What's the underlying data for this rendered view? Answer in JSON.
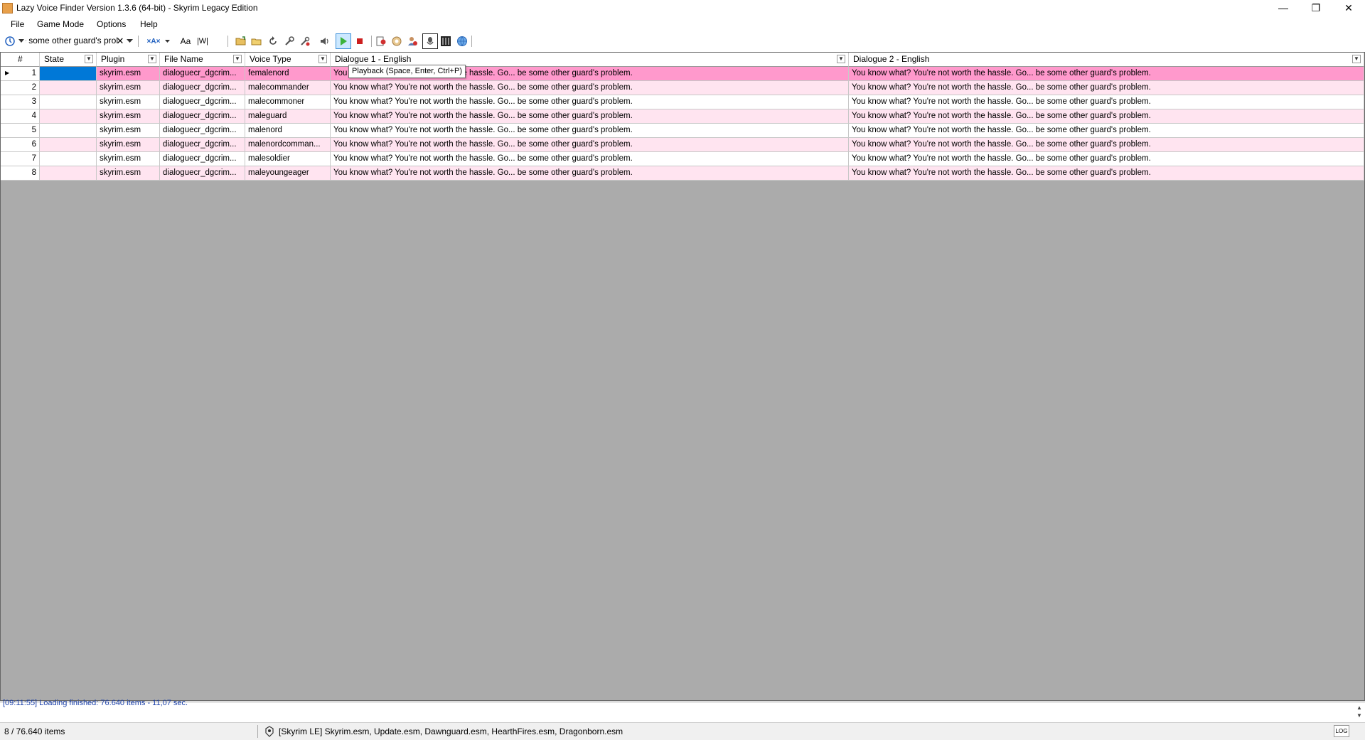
{
  "window": {
    "title": "Lazy Voice Finder Version 1.3.6 (64-bit) - Skyrim Legacy Edition",
    "minimize": "—",
    "restore": "❐",
    "close": "✕"
  },
  "menu": [
    "File",
    "Game Mode",
    "Options",
    "Help"
  ],
  "toolbar": {
    "search_value": "be some other guard's prol",
    "clear_symbol": "✕",
    "case_label": "Aa",
    "whole_word_label": "|W|",
    "regex_label": "×A×",
    "tooltip": "Playback (Space, Enter, Ctrl+P)",
    "icons": [
      "open-folder-icon",
      "open-file-icon",
      "refresh-icon",
      "settings-wrench-icon",
      "tools-icon",
      "volume-icon",
      "play-icon",
      "stop-icon",
      "export-icon",
      "extract-icon",
      "users-icon",
      "voice-icon",
      "matrix-icon",
      "globe-icon"
    ]
  },
  "grid": {
    "columns": [
      "#",
      "State",
      "Plugin",
      "File Name",
      "Voice Type",
      "Dialogue 1 - English",
      "Dialogue 2 - English"
    ],
    "rows": [
      {
        "num": "1",
        "state": "",
        "plugin": "skyrim.esm",
        "file": "dialoguecr_dgcrim...",
        "voice": "femalenord",
        "d1": "You know what? You're not worth the hassle. Go... be some other guard's problem.",
        "d2": "You know what? You're not worth the hassle. Go... be some other guard's problem."
      },
      {
        "num": "2",
        "state": "",
        "plugin": "skyrim.esm",
        "file": "dialoguecr_dgcrim...",
        "voice": "malecommander",
        "d1": "You know what? You're not worth the hassle. Go... be some other guard's problem.",
        "d2": "You know what? You're not worth the hassle. Go... be some other guard's problem."
      },
      {
        "num": "3",
        "state": "",
        "plugin": "skyrim.esm",
        "file": "dialoguecr_dgcrim...",
        "voice": "malecommoner",
        "d1": "You know what? You're not worth the hassle. Go... be some other guard's problem.",
        "d2": "You know what? You're not worth the hassle. Go... be some other guard's problem."
      },
      {
        "num": "4",
        "state": "",
        "plugin": "skyrim.esm",
        "file": "dialoguecr_dgcrim...",
        "voice": "maleguard",
        "d1": "You know what? You're not worth the hassle. Go... be some other guard's problem.",
        "d2": "You know what? You're not worth the hassle. Go... be some other guard's problem."
      },
      {
        "num": "5",
        "state": "",
        "plugin": "skyrim.esm",
        "file": "dialoguecr_dgcrim...",
        "voice": "malenord",
        "d1": "You know what? You're not worth the hassle. Go... be some other guard's problem.",
        "d2": "You know what? You're not worth the hassle. Go... be some other guard's problem."
      },
      {
        "num": "6",
        "state": "",
        "plugin": "skyrim.esm",
        "file": "dialoguecr_dgcrim...",
        "voice": "malenordcomman...",
        "d1": "You know what? You're not worth the hassle. Go... be some other guard's problem.",
        "d2": "You know what? You're not worth the hassle. Go... be some other guard's problem."
      },
      {
        "num": "7",
        "state": "",
        "plugin": "skyrim.esm",
        "file": "dialoguecr_dgcrim...",
        "voice": "malesoldier",
        "d1": "You know what? You're not worth the hassle. Go... be some other guard's problem.",
        "d2": "You know what? You're not worth the hassle. Go... be some other guard's problem."
      },
      {
        "num": "8",
        "state": "",
        "plugin": "skyrim.esm",
        "file": "dialoguecr_dgcrim...",
        "voice": "maleyoungeager",
        "d1": "You know what? You're not worth the hassle. Go... be some other guard's problem.",
        "d2": "You know what? You're not worth the hassle. Go... be some other guard's problem."
      }
    ]
  },
  "log": {
    "text": "[09:11:55] Loading finished: 76.640 items - 11,07 sec."
  },
  "status": {
    "count": "8 / 76.640 items",
    "plugins": "[Skyrim LE] Skyrim.esm, Update.esm, Dawnguard.esm, HearthFires.esm, Dragonborn.esm",
    "log_button": "LOG"
  },
  "colors": {
    "selected_row": "#ff99cc",
    "alt_row": "#ffe4f0",
    "selected_cell": "#0078d7",
    "grid_background": "#ababab",
    "play_button": "#cce8ff"
  }
}
